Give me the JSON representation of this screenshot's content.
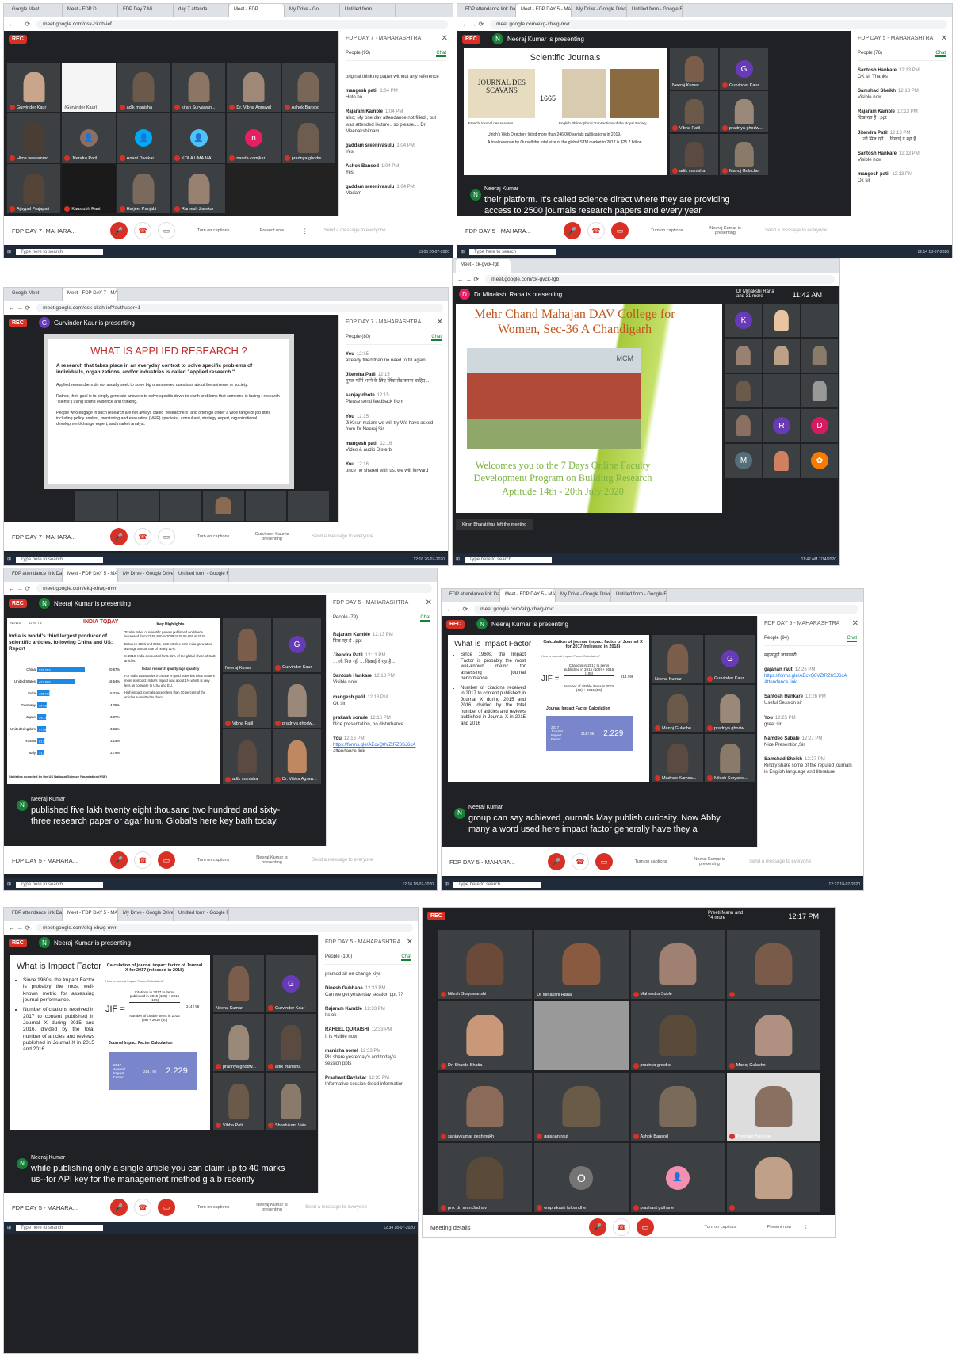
{
  "common": {
    "rec": "REC",
    "people_tab": "People",
    "chat_tab": "Chat",
    "send_placeholder": "Send a message to everyone",
    "taskbar_search": "Type here to search",
    "turn_on_captions": "Turn on captions",
    "present_now": "Present now",
    "more": "⋮"
  },
  "s1": {
    "url": "meet.google.com/osk-ckoh-ief",
    "tabs": [
      "Google Meet",
      "Meet - FDP D",
      "FDP Day 7 Mi",
      "day 7 attenda",
      "Meet - FDP",
      "My Drive - Go",
      "Untitled form",
      "FDP Day 7 Mi"
    ],
    "meeting": "FDP DAY 7- MAHARA...",
    "side_title": "FDP DAY 7 · MAHARASHTRA",
    "people": "People (93)",
    "tiles": [
      "Gurvinder Kaur",
      "(Gurvinder Kaur)",
      "adik manisha",
      "kiran Suryawan...",
      "Dr. Vibha Agrawal",
      "Ashok Bansod",
      "Hima veerammd...",
      "Jitendra Patil",
      "Anant Divekar",
      "KOLA UMA MA...",
      "nanda kamjkar",
      "pradnya ghodw...",
      "Ajaypal Prajapati",
      "Kaustubh Raut",
      "Harjeet Panjabi",
      "Ramesh Zarekar"
    ],
    "chat": [
      {
        "who": "",
        "time": "",
        "text": "original thinking paper without any reference"
      },
      {
        "who": "mangesh patil",
        "time": "1:04 PM",
        "text": "Hoto ho"
      },
      {
        "who": "Rajaram Kamble",
        "time": "1:04 PM",
        "text": "also; My one day attendance not filled , but I was attended lecture.. so please.... Dr. Meenakshimam"
      },
      {
        "who": "gaddam sreenivasulu",
        "time": "1:04 PM",
        "text": "Yes"
      },
      {
        "who": "Ashok Bansod",
        "time": "1:04 PM",
        "text": "Yes"
      },
      {
        "who": "gaddam sreenivasulu",
        "time": "1:04 PM",
        "text": "Madam"
      }
    ],
    "time": "13:05 26-07-2020"
  },
  "s2": {
    "url": "meet.google.com/ekg-xhwg-mvr",
    "tabs": [
      "FDP attendance link Day 5",
      "Meet - FDP DAY 5 - MAHAR",
      "My Drive - Google Drive",
      "Untitled form - Google Forms"
    ],
    "presenter": "Neeraj Kumar is presenting",
    "meeting": "FDP DAY 5 - MAHARA...",
    "side_title": "FDP DAY 5 - MAHARASHTRA",
    "people": "People (76)",
    "slide_title": "Scientific Journals",
    "slide_year": "1665",
    "slide_journal": "JOURNAL DES SCAVANS",
    "slide_caption1": "French Journal des sçavans",
    "slide_caption2": "English Philosophical Transactions of the Royal Society",
    "slide_bullet1": "Ulrich's Web Directory listed more than 246,000 serials publications in 2019.",
    "slide_bullet2": "A total revenue by Outsell the total size of the global STM market in 2017 is $25.7 billion",
    "tiles": [
      "Neeraj Kumar",
      "Gurvinder Kaur",
      "Vibha Patil",
      "pradnya ghodw...",
      "adik manisha",
      "Manoj Gulache"
    ],
    "caption_speaker": "Neeraj Kumar",
    "caption_text": "their platform. It's called science direct where they are providing access to 2500 journals research papers and every year",
    "chat": [
      {
        "who": "Santosh Hankare",
        "time": "12:13 PM",
        "text": "OK sir Thanks"
      },
      {
        "who": "Samshad Sheikh",
        "time": "12:13 PM",
        "text": "Visible now"
      },
      {
        "who": "Rajaram Kamble",
        "time": "12:13 PM",
        "text": "दिख रहा है . ppt"
      },
      {
        "who": "Jitendra Patil",
        "time": "12:13 PM",
        "text": "... जी मिल रही ... दिखाई दे रहा है..."
      },
      {
        "who": "Santosh Hankare",
        "time": "12:13 PM",
        "text": "Visible now"
      },
      {
        "who": "mangesh patil",
        "time": "12:13 PM",
        "text": "Ok sir"
      }
    ],
    "present_label": "Neeraj Kumar is presenting",
    "time": "12:14 18-07-2020"
  },
  "s3": {
    "url": "meet.google.com/osk-ckoh-ief?authuser=1",
    "tabs": [
      "Google Meet",
      "Meet - FDP DAY 7 - MAHAR"
    ],
    "presenter": "Gurvinder Kaur is presenting",
    "meeting": "FDP DAY 7- MAHARA...",
    "side_title": "FDP DAY 7 · MAHARASHTRA",
    "people": "People (80)",
    "slide_title": "WHAT IS APPLIED RESEARCH ?",
    "slide_lead": "A research that takes place in an everyday context to solve specific problems of individuals, organizations, and/or industries is called \"applied research.\"",
    "slide_p1": "Applied researchers do not usually seek to solve big unanswered questions about the universe or society.",
    "slide_p2": "Rather, their goal is to simply generate answers to solve specific down-to-earth problems that someone is facing ( research \"clients\") using sound evidence and thinking.",
    "slide_p3": "People who engage in such research are not always called \"researchers\" and often go under a wide range of job titles including policy analyst, monitoring and evaluation (M&E) specialist, consultant, strategy expert, organizational development/change expert, and market analyst.",
    "chat": [
      {
        "who": "You",
        "time": "12:15",
        "text": "already filled then no need to fill again"
      },
      {
        "who": "Jitendra Patil",
        "time": "12:15",
        "text": "गूगल फॉर्म भरने के लिए लिंक सेंड करना चाहिए..."
      },
      {
        "who": "sanjay dhote",
        "time": "12:15",
        "text": "Please send feedback from"
      },
      {
        "who": "You",
        "time": "12:15",
        "text": "Ji Kiran maiam we will try We have asked from Dr Neeraj Sir"
      },
      {
        "who": "mangesh patil",
        "time": "12:16",
        "text": "Video & audio Disterb"
      },
      {
        "who": "You",
        "time": "12:16",
        "text": "once he shared with us, we will forward"
      }
    ],
    "present_label": "Gurvinder Kaur is presenting",
    "time": "12:16 26-07-2020"
  },
  "s4": {
    "url": "meet.google.com/ck-gvck-fgb",
    "tabs": [
      "Meet - ck-gvck-fgb"
    ],
    "presenter": "Dr Minakshi Rana is presenting",
    "top_name": "Dr Minakshi Rana and 31 more",
    "clock": "11:42 AM",
    "slide_title": "Mehr Chand Mahajan DAV College for Women, Sec-36 A Chandigarh",
    "slide_sign": "MCM",
    "slide_welcome": "Welcomes you to the  7 Days Online Faculty Development Program on Building Research Aptitude 14th - 20th July 2020",
    "notice": "Kiran Bharati has left the meeting",
    "circles": [
      "K",
      "R",
      "D",
      "M"
    ],
    "time": "11:42 AM 7/14/2020"
  },
  "s5": {
    "url": "meet.google.com/ekg-xhwg-mvr",
    "tabs": [
      "FDP attendance link Day 5",
      "Meet - FDP DAY 5 - MAHAR",
      "My Drive - Google Drive",
      "Untitled form - Google Forms"
    ],
    "presenter": "Neeraj Kumar is presenting",
    "meeting": "FDP DAY 5 - MAHARA...",
    "side_title": "FDP DAY 5 - MAHARASHTRA",
    "people": "People (79)",
    "slide_logo": "INDIA TODAY",
    "slide_nav": [
      "NEWS",
      "LIVE TV",
      "APP"
    ],
    "slide_headline": "India is world's third largest producer of scientific articles, following China and US: Report",
    "slide_key": "Key Highlights",
    "slide_footer": "Statistics compiled by the US National Science Foundation (NSF)",
    "slide_highlights": [
      "Total number of scientific papers published worldwide increased from 17,55,850 in 2008 to 25,55,959 in 2018.",
      "Between 2008 and 2018, S&E articles from India grew at an average annual rate of nearly 11%.",
      "In 2018, India accounted for 5.31% of the global share of S&E articles.",
      "Indian research quality lags quantity",
      "For India quantitative increase is good news but what matters more is impact. India's impact was about 1% which is very less as compare to USA and EU.",
      "High-impact journals accept less than 10 percent of the articles submitted to them."
    ],
    "countries": [
      "China",
      "United States",
      "India",
      "Germany",
      "Japan",
      "United Kingdom",
      "Russia",
      "Italy"
    ],
    "country_values": [
      "528,263",
      "422,808",
      "135,788",
      "104,396",
      "98,793",
      "97,681",
      "81,579",
      "71,240"
    ],
    "country_shares": [
      "20.67%",
      "16.54%",
      "5.31%",
      "4.08%",
      "3.87%",
      "3.82%",
      "3.19%",
      "2.79%"
    ],
    "tiles": [
      "Neeraj Kumar",
      "Gurvinder Kaur",
      "Vibha Patil",
      "pradnya ghodw...",
      "adik manisha",
      "Dr. Vibha Agraw..."
    ],
    "caption_speaker": "Neeraj Kumar",
    "caption_text": "published five lakh twenty eight thousand two hundred and sixty-three research paper or agar hum. Global's here key bath today.",
    "chat": [
      {
        "who": "Rajaram Kamble",
        "time": "12:13 PM",
        "text": "दिख रहा है . ppt"
      },
      {
        "who": "Jitendra Patil",
        "time": "12:13 PM",
        "text": "... जी मिल रही ... दिखाई दे रहा है..."
      },
      {
        "who": "Santosh Hankare",
        "time": "12:13 PM",
        "text": "Visible now"
      },
      {
        "who": "mangesh patil",
        "time": "12:13 PM",
        "text": "Ok sir"
      },
      {
        "who": "prakash sonule",
        "time": "12:16 PM",
        "text": "Nice presentation, no disturbance"
      },
      {
        "who": "You",
        "time": "12:16 PM",
        "text": "https://forms.gle/AEcvQ8VZtRZ6SJ6cA"
      },
      {
        "who": "",
        "time": "",
        "text": "attendance link"
      }
    ],
    "present_label": "Neeraj Kumar is presenting",
    "time": "12:16 18-07-2020"
  },
  "s6": {
    "url": "meet.google.com/ekg-xhwg-mvr",
    "tabs": [
      "FDP attendance link Day 5",
      "Meet - FDP DAY 5 - MAHAR",
      "My Drive - Google Drive",
      "Untitled form - Google Forms"
    ],
    "presenter": "Neeraj Kumar is presenting",
    "meeting": "FDP DAY 5 - MAHARA...",
    "side_title": "FDP DAY 5 - MAHARASHTRA",
    "people": "People (94)",
    "slide_title": "What is Impact Factor",
    "slide_bullets": [
      "Since 1960s, the Impact Factor is probably the most well-known metric for assessing journal performance.",
      "Number of citations received in 2017 to content published in Journal X during 2015 and 2016, divided by the total number of articles and reviews published in Journal X in 2015 and 2016"
    ],
    "slide_calc_title": "Calculation of journal impact factor of Journal X for 2017 (released in 2018)",
    "slide_howto": "How is Journal Impact Factor Calculated?",
    "slide_jif": "JIF =",
    "slide_num": "Citations in 2017 to items published in 2015 (109) + 2016 (105)",
    "slide_den": "Number of citable items in 2015 (46) + 2016 (50)",
    "slide_frac": "214 / 96",
    "slide_calc": "Journal Impact Factor Calculation",
    "slide_box": "2017 Journal Impact Factor",
    "slide_result": "2.229",
    "tiles": [
      "Neeraj Kumar",
      "Gurvinder Kaur",
      "Manoj Gulache",
      "pradnya ghodw...",
      "Madhao Kamda...",
      "Nilesh Suryawa..."
    ],
    "caption_speaker": "Neeraj Kumar",
    "caption_text": "group can say achieved journals May publish curiosity. Now Abby many a word used here impact factor generally have they a",
    "chat": [
      {
        "who": "",
        "time": "",
        "text": "महत्वपूर्ण जानकारी"
      },
      {
        "who": "gajanan raut",
        "time": "12:25 PM",
        "text": "https://forms.gle/AEcvQ8VZtRZ6SJ6cA Attendance link"
      },
      {
        "who": "Santosh Hankare",
        "time": "12:26 PM",
        "text": "Useful Session sir"
      },
      {
        "who": "You",
        "time": "12:25 PM",
        "text": "great sir"
      },
      {
        "who": "Namdeo Sabale",
        "time": "12:27 PM",
        "text": "Nice Presention,Sir"
      },
      {
        "who": "Samshad Sheikh",
        "time": "12:27 PM",
        "text": "Kindly share some of the reputed journals in English language and literature"
      }
    ],
    "present_label": "Neeraj Kumar is presenting",
    "time": "12:27 18-07-2020"
  },
  "s7": {
    "url": "meet.google.com/ekg-xhwg-mvr",
    "tabs": [
      "FDP attendance link Day 5",
      "Meet - FDP DAY 5 - MAHAR",
      "My Drive - Google Drive",
      "Untitled form - Google Forms"
    ],
    "presenter": "Neeraj Kumar is presenting",
    "meeting": "FDP DAY 5 - MAHARA...",
    "side_title": "FDP DAY 5 - MAHARASHTRA",
    "people": "People (100)",
    "tiles": [
      "Neeraj Kumar",
      "Gurvinder Kaur",
      "pradnya ghodw...",
      "adik manisha",
      "Vibha Patil",
      "Shashikant Vais..."
    ],
    "caption_speaker": "Neeraj Kumar",
    "caption_text": "while publishing only a single article you can claim up to 40 marks us--for API key for the management method g a b recently",
    "chat": [
      {
        "who": "",
        "time": "",
        "text": "pramod sir ne change kiya"
      },
      {
        "who": "Dinesh Gubhane",
        "time": "12:33 PM",
        "text": "Can we get yesterday session ppt.??"
      },
      {
        "who": "Rajaram Kamble",
        "time": "12:33 PM",
        "text": "Its ok"
      },
      {
        "who": "RAHEEL QURAISHI",
        "time": "12:33 PM",
        "text": "It is visible now"
      },
      {
        "who": "manisha sonel",
        "time": "12:33 PM",
        "text": "Pls share yesterday's and today's session ppts"
      },
      {
        "who": "Prashant Bavlskar",
        "time": "12:33 PM",
        "text": "Informative session Good information"
      }
    ],
    "present_label": "Neeraj Kumar is presenting",
    "time": "12:34 18-07-2020"
  },
  "s8": {
    "top_name": "Preeti Mann and 74 more",
    "clock": "12:17 PM",
    "tiles": [
      "Nilesh Suryawanshi",
      "Dr Minakshi Rana",
      "Mahendra Suble",
      "",
      "Dr. Sharda Bhatia",
      "",
      "pradnya ghodke",
      "Manoj Gulache",
      "sanjaykumar deshmukh",
      "gajanan raut",
      "Ashok Bansod",
      "Prashant Bavlskar",
      "pro. dr. arun Jadhav",
      "omprakash fulbandhe",
      "prashant gulhane",
      ""
    ],
    "o_letter": "O",
    "meeting_details": "Meeting details"
  },
  "colors": {
    "red": "#d93025",
    "green": "#188038",
    "meet_bg": "#202124",
    "purple": "#673ab7"
  }
}
